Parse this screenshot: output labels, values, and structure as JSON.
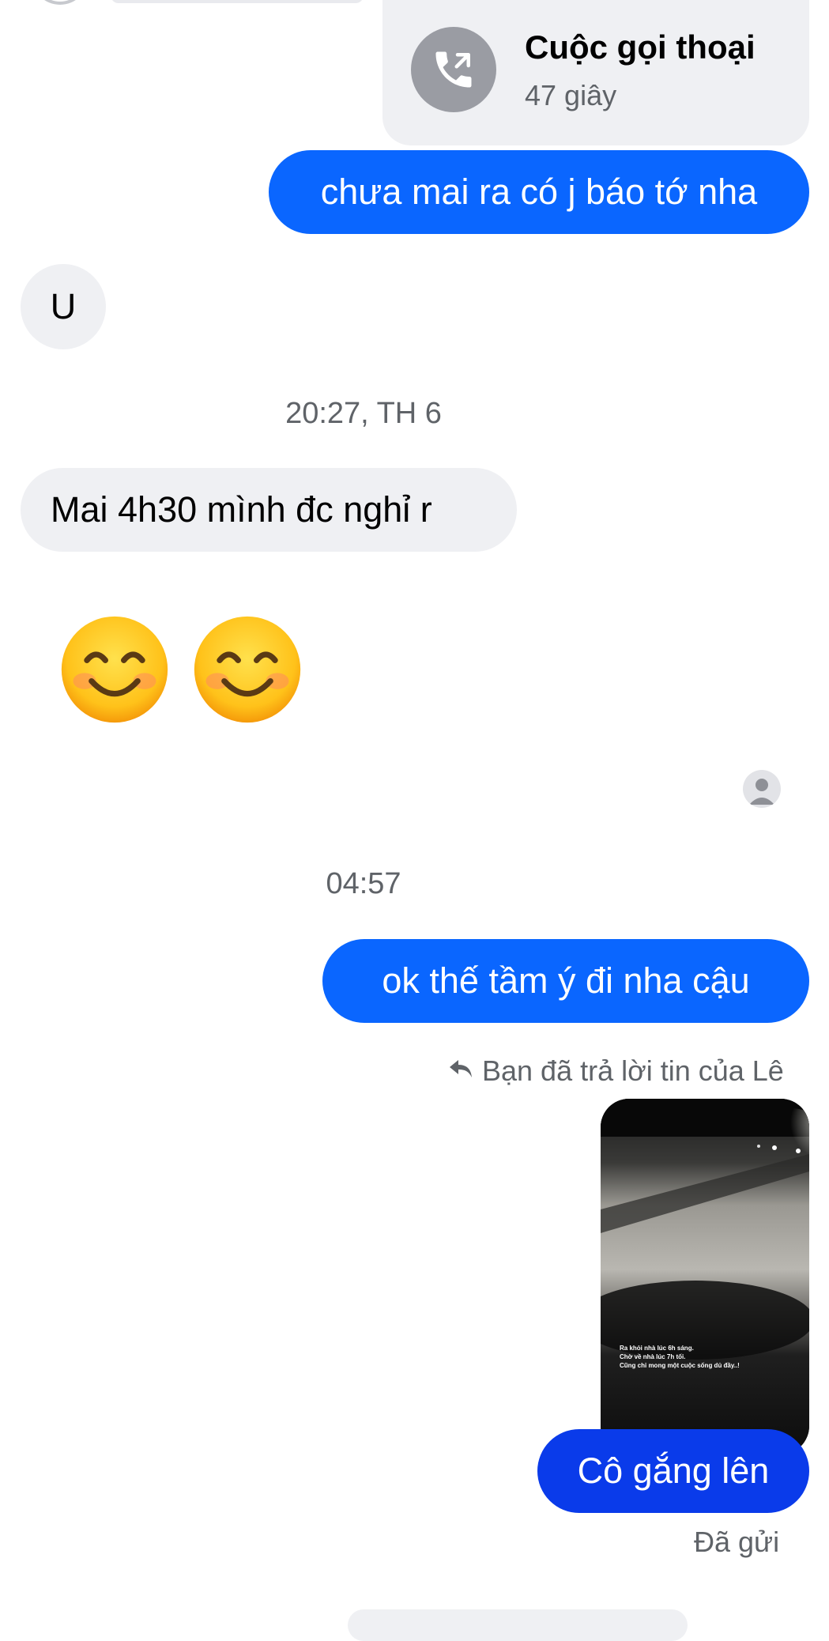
{
  "call": {
    "title": "Cuộc gọi thoại",
    "duration": "47 giây"
  },
  "messages": {
    "m1": "chưa mai ra có j báo tớ nha",
    "m2": "U",
    "m3": "Mai 4h30 mình đc nghỉ r",
    "m4": "ok thế  tầm ý đi nha cậu",
    "m5": "Cô gắng lên"
  },
  "timestamps": {
    "t1": "20:27, TH 6",
    "t2": "04:57"
  },
  "reply_note": "Bạn đã trả lời tin của Lê",
  "photo_caption": [
    "Ra khỏi nhà lúc 6h sáng.",
    "Chờ về nhà lúc 7h tối.",
    "Cũng chỉ mong một cuộc sống dủ đầy..!"
  ],
  "status": "Đã gửi",
  "colors": {
    "outgoing": "#0a66ff",
    "incoming": "#eff0f3",
    "last_outgoing": "#0a3bea"
  },
  "icons": {
    "call": "phone-call-icon",
    "reply": "reply-arrow-icon",
    "seen": "seen-avatar-icon",
    "emoji": "smiling-face-emoji"
  }
}
